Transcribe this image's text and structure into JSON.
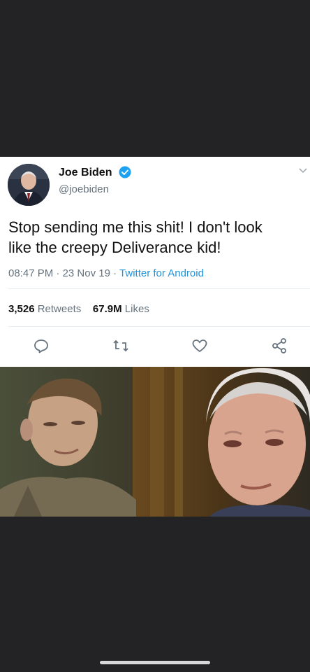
{
  "tweet": {
    "display_name": "Joe Biden",
    "handle": "@joebiden",
    "verified": true,
    "text_line1": "Stop sending me this shit! I don't look",
    "text_line2": "like the creepy Deliverance kid!",
    "time": "08:47 PM",
    "date": "23 Nov 19",
    "source": "Twitter for Android",
    "retweets_count": "3,526",
    "retweets_label": "Retweets",
    "likes_count": "67.9M",
    "likes_label": "Likes"
  },
  "actions": {
    "reply_icon": "reply-icon",
    "retweet_icon": "retweet-icon",
    "like_icon": "heart-icon",
    "share_icon": "share-icon"
  },
  "colors": {
    "background": "#232326",
    "card": "#ffffff",
    "link": "#1b95e0",
    "muted": "#66737e",
    "verified": "#1da1f2"
  }
}
